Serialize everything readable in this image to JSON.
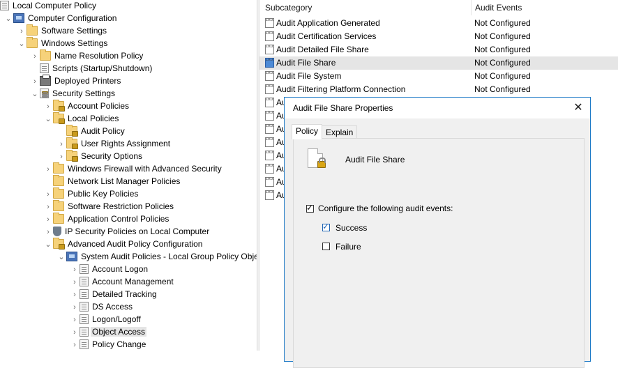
{
  "tree": {
    "items": [
      {
        "label": "Local Computer Policy",
        "expander": "",
        "icon": "policy-doc-icon"
      },
      {
        "label": "Computer Configuration",
        "expander": "⌄",
        "icon": "computer-icon"
      },
      {
        "label": "Software Settings",
        "expander": "›",
        "icon": "folder-icon"
      },
      {
        "label": "Windows Settings",
        "expander": "⌄",
        "icon": "folder-icon"
      },
      {
        "label": "Name Resolution Policy",
        "expander": "›",
        "icon": "folder-icon"
      },
      {
        "label": "Scripts (Startup/Shutdown)",
        "expander": "",
        "icon": "script-doc-icon"
      },
      {
        "label": "Deployed Printers",
        "expander": "›",
        "icon": "printer-icon"
      },
      {
        "label": "Security Settings",
        "expander": "⌄",
        "icon": "security-settings-icon"
      },
      {
        "label": "Account Policies",
        "expander": "›",
        "icon": "locked-folder-icon"
      },
      {
        "label": "Local Policies",
        "expander": "⌄",
        "icon": "locked-folder-icon"
      },
      {
        "label": "Audit Policy",
        "expander": "",
        "icon": "locked-folder-icon"
      },
      {
        "label": "User Rights Assignment",
        "expander": "›",
        "icon": "locked-folder-icon"
      },
      {
        "label": "Security Options",
        "expander": "›",
        "icon": "locked-folder-icon"
      },
      {
        "label": "Windows Firewall with Advanced Security",
        "expander": "›",
        "icon": "folder-icon"
      },
      {
        "label": "Network List Manager Policies",
        "expander": "",
        "icon": "folder-icon"
      },
      {
        "label": "Public Key Policies",
        "expander": "›",
        "icon": "folder-icon"
      },
      {
        "label": "Software Restriction Policies",
        "expander": "›",
        "icon": "folder-icon"
      },
      {
        "label": "Application Control Policies",
        "expander": "›",
        "icon": "folder-icon"
      },
      {
        "label": "IP Security Policies on Local Computer",
        "expander": "›",
        "icon": "ip-security-icon"
      },
      {
        "label": "Advanced Audit Policy Configuration",
        "expander": "⌄",
        "icon": "locked-folder-icon"
      },
      {
        "label": "System Audit Policies - Local Group Policy Objec",
        "expander": "⌄",
        "icon": "audit-policies-icon"
      },
      {
        "label": "Account Logon",
        "expander": "›",
        "icon": "audit-doc-icon"
      },
      {
        "label": "Account Management",
        "expander": "›",
        "icon": "audit-doc-icon"
      },
      {
        "label": "Detailed Tracking",
        "expander": "›",
        "icon": "audit-doc-icon"
      },
      {
        "label": "DS Access",
        "expander": "›",
        "icon": "audit-doc-icon"
      },
      {
        "label": "Logon/Logoff",
        "expander": "›",
        "icon": "audit-doc-icon"
      },
      {
        "label": "Object Access",
        "expander": "›",
        "icon": "audit-doc-icon",
        "selected": true
      },
      {
        "label": "Policy Change",
        "expander": "›",
        "icon": "audit-doc-icon"
      }
    ]
  },
  "list": {
    "col_subcategory": "Subcategory",
    "col_audit_events": "Audit Events",
    "rows": [
      {
        "subcategory": "Audit Application Generated",
        "events": "Not Configured"
      },
      {
        "subcategory": "Audit Certification Services",
        "events": "Not Configured"
      },
      {
        "subcategory": "Audit Detailed File Share",
        "events": "Not Configured"
      },
      {
        "subcategory": "Audit File Share",
        "events": "Not Configured",
        "selected": true
      },
      {
        "subcategory": "Audit File System",
        "events": "Not Configured"
      },
      {
        "subcategory": "Audit Filtering Platform Connection",
        "events": "Not Configured"
      },
      {
        "subcategory": "Au",
        "events": ""
      },
      {
        "subcategory": "Au",
        "events": ""
      },
      {
        "subcategory": "Au",
        "events": ""
      },
      {
        "subcategory": "Au",
        "events": ""
      },
      {
        "subcategory": "Au",
        "events": ""
      },
      {
        "subcategory": "Au",
        "events": ""
      },
      {
        "subcategory": "Au",
        "events": ""
      },
      {
        "subcategory": "Au",
        "events": ""
      }
    ],
    "binary_icon_text": "1010 0101 1010"
  },
  "dialog": {
    "title": "Audit File Share Properties",
    "close_glyph": "✕",
    "tabs": [
      "Policy",
      "Explain"
    ],
    "active_tab": "Policy",
    "policy_name": "Audit File Share",
    "configure_label": "Configure the following audit events:",
    "configure_checked": true,
    "success_label": "Success",
    "success_checked": true,
    "failure_label": "Failure",
    "failure_checked": false,
    "check_glyph": "✓"
  },
  "colors": {
    "selection": "#e5e5e5",
    "dialog_border": "#1c79c6",
    "checkbox_blue": "#2267b5"
  }
}
